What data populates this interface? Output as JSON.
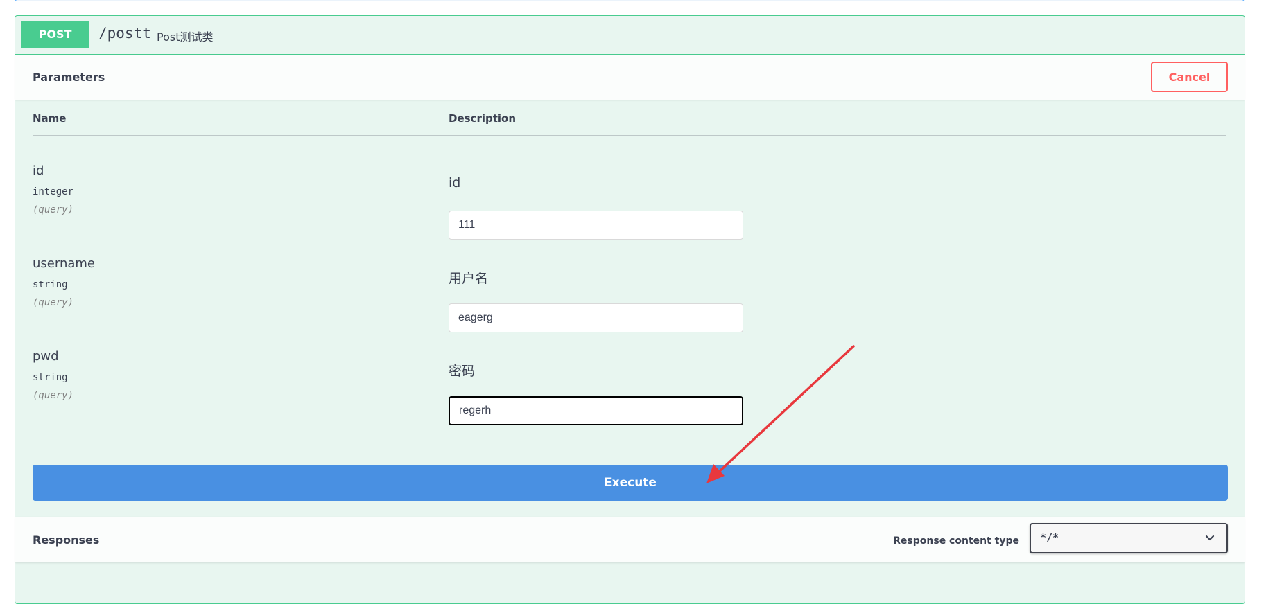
{
  "operation": {
    "method": "POST",
    "path": "/postt",
    "description": "Post测试类"
  },
  "parameters": {
    "title": "Parameters",
    "cancel_label": "Cancel",
    "col_name": "Name",
    "col_description": "Description",
    "items": [
      {
        "name": "id",
        "type": "integer",
        "in": "(query)",
        "description": "id",
        "value": "111"
      },
      {
        "name": "username",
        "type": "string",
        "in": "(query)",
        "description": "用户名",
        "value": "eagerg"
      },
      {
        "name": "pwd",
        "type": "string",
        "in": "(query)",
        "description": "密码",
        "value": "regerh"
      }
    ]
  },
  "execute_label": "Execute",
  "responses": {
    "title": "Responses",
    "content_type_label": "Response content type",
    "content_type_value": "*/*"
  },
  "colors": {
    "post_green": "#49cc90",
    "execute_blue": "#4990e2",
    "cancel_red": "#ff6060",
    "annotation_arrow": "#e8383d"
  },
  "icons": {
    "select_arrow": "chevron-down-icon",
    "annotation": "red-arrow-annotation"
  }
}
